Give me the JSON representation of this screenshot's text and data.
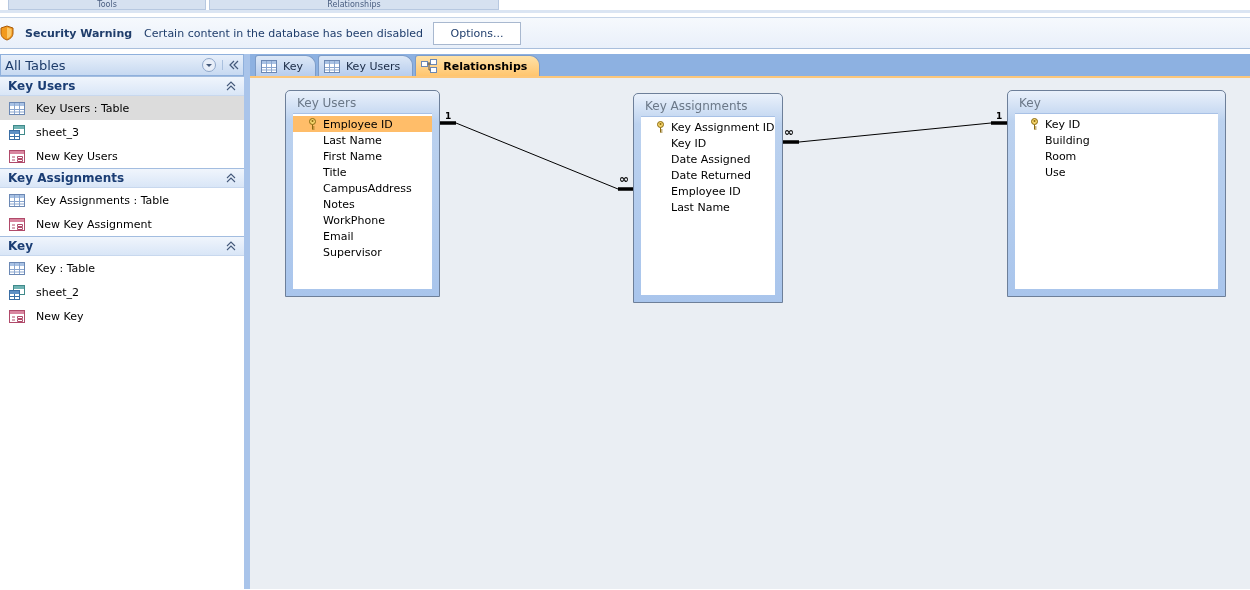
{
  "ribbon_tabs": [
    {
      "label": "Tools"
    },
    {
      "label": "Relationships"
    }
  ],
  "message_bar": {
    "title": "Security Warning",
    "message": "Certain content in the database has been disabled",
    "button": "Options..."
  },
  "navigation_pane": {
    "title": "All Tables",
    "groups": [
      {
        "title": "Key Users",
        "expanded": true,
        "items": [
          {
            "kind": "table",
            "label": "Key Users : Table",
            "selected": true
          },
          {
            "kind": "query",
            "label": "sheet_3",
            "selected": false
          },
          {
            "kind": "form",
            "label": "New Key Users",
            "selected": false
          }
        ]
      },
      {
        "title": "Key Assignments",
        "expanded": true,
        "items": [
          {
            "kind": "table",
            "label": "Key Assignments : Table",
            "selected": false
          },
          {
            "kind": "form",
            "label": "New Key Assignment",
            "selected": false
          }
        ]
      },
      {
        "title": "Key",
        "expanded": true,
        "items": [
          {
            "kind": "table",
            "label": "Key : Table",
            "selected": false
          },
          {
            "kind": "query",
            "label": "sheet_2",
            "selected": false
          },
          {
            "kind": "form",
            "label": "New Key",
            "selected": false
          }
        ]
      }
    ]
  },
  "document_tabs": [
    {
      "kind": "table",
      "label": "Key",
      "selected": false
    },
    {
      "kind": "table",
      "label": "Key Users",
      "selected": false
    },
    {
      "kind": "relationships",
      "label": "Relationships",
      "selected": true
    }
  ],
  "tables": [
    {
      "title": "Key Users",
      "fields": [
        {
          "name": "Employee ID",
          "primary_key": true,
          "selected": true
        },
        {
          "name": "Last Name",
          "primary_key": false,
          "selected": false
        },
        {
          "name": "First Name",
          "primary_key": false,
          "selected": false
        },
        {
          "name": "Title",
          "primary_key": false,
          "selected": false
        },
        {
          "name": "CampusAddress",
          "primary_key": false,
          "selected": false
        },
        {
          "name": "Notes",
          "primary_key": false,
          "selected": false
        },
        {
          "name": "WorkPhone",
          "primary_key": false,
          "selected": false
        },
        {
          "name": "Email",
          "primary_key": false,
          "selected": false
        },
        {
          "name": "Supervisor",
          "primary_key": false,
          "selected": false
        }
      ]
    },
    {
      "title": "Key Assignments",
      "fields": [
        {
          "name": "Key Assignment ID",
          "primary_key": true,
          "selected": false
        },
        {
          "name": "Key ID",
          "primary_key": false,
          "selected": false
        },
        {
          "name": "Date Assigned",
          "primary_key": false,
          "selected": false
        },
        {
          "name": "Date Returned",
          "primary_key": false,
          "selected": false
        },
        {
          "name": "Employee ID",
          "primary_key": false,
          "selected": false
        },
        {
          "name": "Last Name",
          "primary_key": false,
          "selected": false
        }
      ]
    },
    {
      "title": "Key",
      "fields": [
        {
          "name": "Key ID",
          "primary_key": true,
          "selected": false
        },
        {
          "name": "Building",
          "primary_key": false,
          "selected": false
        },
        {
          "name": "Room",
          "primary_key": false,
          "selected": false
        },
        {
          "name": "Use",
          "primary_key": false,
          "selected": false
        }
      ]
    }
  ],
  "relationships": [
    {
      "one_label": "1",
      "many_label": "∞"
    },
    {
      "one_label": "1",
      "many_label": "∞"
    }
  ]
}
